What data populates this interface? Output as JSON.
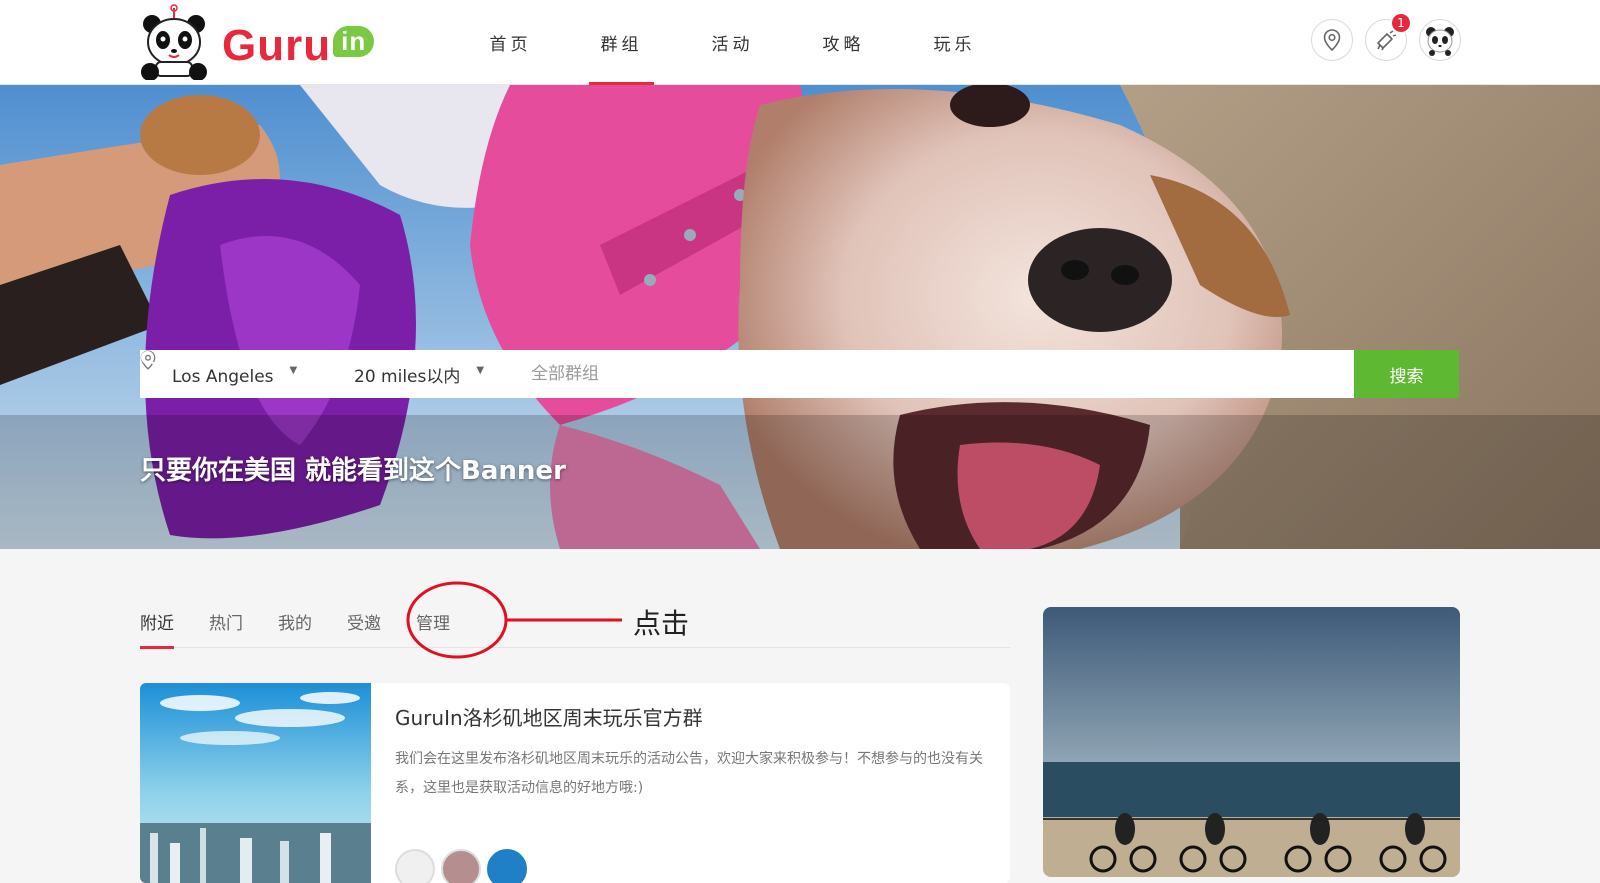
{
  "header": {
    "logo_text": "Guru",
    "logo_badge": "in",
    "nav": [
      {
        "label": "首页",
        "active": false
      },
      {
        "label": "群组",
        "active": true
      },
      {
        "label": "活动",
        "active": false
      },
      {
        "label": "攻略",
        "active": false
      },
      {
        "label": "玩乐",
        "active": false
      }
    ],
    "icons": [
      "location-icon",
      "notification-icon",
      "user-avatar"
    ],
    "notification_count": "1"
  },
  "search": {
    "location": "Los Angeles",
    "range": "20 miles以内",
    "placeholder": "全部群组",
    "button_label": "搜索"
  },
  "banner": {
    "text": "只要你在美国 就能看到这个Banner"
  },
  "tabs": [
    {
      "label": "附近",
      "active": true
    },
    {
      "label": "热门",
      "active": false
    },
    {
      "label": "我的",
      "active": false
    },
    {
      "label": "受邀",
      "active": false
    },
    {
      "label": "管理",
      "active": false
    }
  ],
  "annotation": {
    "text": "点击"
  },
  "group_card": {
    "title": "GuruIn洛杉矶地区周末玩乐官方群",
    "description": "我们会在这里发布洛杉矶地区周末玩乐的活动公告，欢迎大家来积极参与！不想参与的也没有关系，这里也是获取活动信息的好地方哦:)"
  },
  "colors": {
    "brand_red": "#e8283c",
    "brand_green": "#5fb832",
    "logo_green": "#7ac943"
  }
}
